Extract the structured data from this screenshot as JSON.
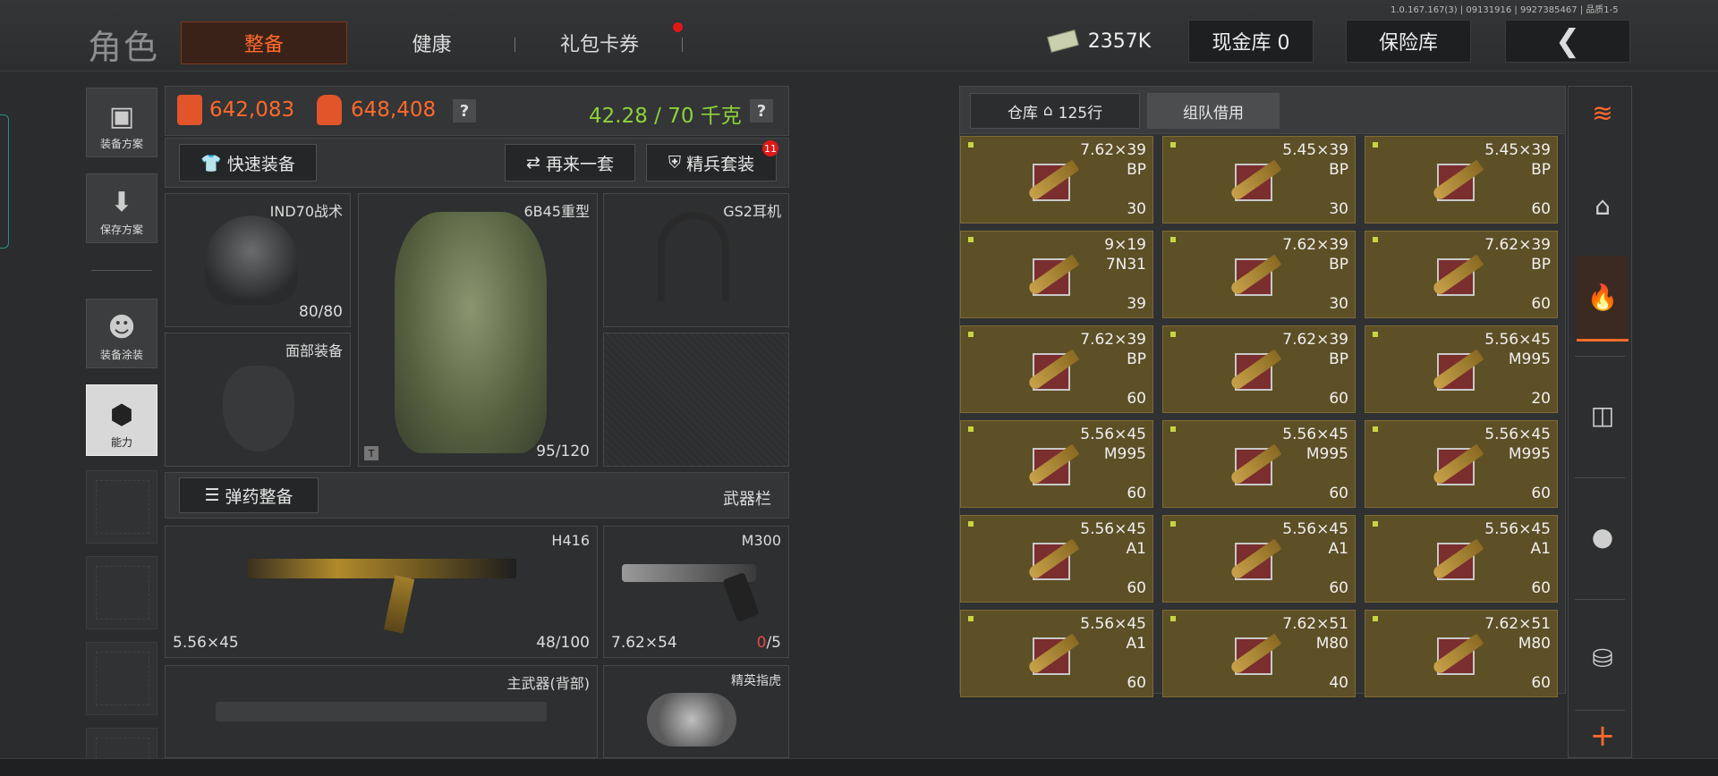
{
  "header": {
    "title": "角色",
    "tabs": [
      "整备",
      "健康",
      "礼包卡券"
    ],
    "version": "1.0.167.167(3) | 09131916 | 9927385467 | 品质1-5",
    "money": "2357K",
    "cash_vault": "现金库 0",
    "insurance": "保险库"
  },
  "left_nav": [
    "装备方案",
    "保存方案",
    "装备涂装",
    "能力"
  ],
  "stats": {
    "value1": "642,083",
    "value2": "648,408",
    "weight": "42.28 / 70 千克",
    "q": "?"
  },
  "toolbar": {
    "quick_equip": "快速装备",
    "again": "再来一套",
    "elite": "精兵套装",
    "elite_badge": "11",
    "ammo_equip": "弹药整备",
    "weapon_bar": "武器栏"
  },
  "slots": {
    "helmet_name": "IND70战术",
    "helmet_dur": "80/80",
    "face": "面部装备",
    "armor_name": "6B45重型",
    "armor_dur": "95/120",
    "armor_mark": "T",
    "headset": "GS2耳机",
    "primary_name": "H416",
    "primary_cal": "5.56×45",
    "primary_dur": "48/100",
    "sidearm_name": "M300",
    "sidearm_cal": "7.62×54",
    "sidearm_ammo_cur": "0",
    "sidearm_ammo_max": "/5",
    "back_weapon": "主武器(背部)",
    "melee": "精英指虎"
  },
  "storage": {
    "tab_warehouse": "仓库",
    "rows": "125行",
    "tab_team": "组队借用",
    "items": [
      {
        "cal": "7.62×39",
        "type": "BP",
        "qty": "30"
      },
      {
        "cal": "5.45×39",
        "type": "BP",
        "qty": "30"
      },
      {
        "cal": "5.45×39",
        "type": "BP",
        "qty": "60"
      },
      {
        "cal": "9×19",
        "type": "7N31",
        "qty": "39"
      },
      {
        "cal": "7.62×39",
        "type": "BP",
        "qty": "30"
      },
      {
        "cal": "7.62×39",
        "type": "BP",
        "qty": "60"
      },
      {
        "cal": "7.62×39",
        "type": "BP",
        "qty": "60"
      },
      {
        "cal": "7.62×39",
        "type": "BP",
        "qty": "60"
      },
      {
        "cal": "5.56×45",
        "type": "M995",
        "qty": "20"
      },
      {
        "cal": "5.56×45",
        "type": "M995",
        "qty": "60"
      },
      {
        "cal": "5.56×45",
        "type": "M995",
        "qty": "60"
      },
      {
        "cal": "5.56×45",
        "type": "M995",
        "qty": "60"
      },
      {
        "cal": "5.56×45",
        "type": "A1",
        "qty": "60"
      },
      {
        "cal": "5.56×45",
        "type": "A1",
        "qty": "60"
      },
      {
        "cal": "5.56×45",
        "type": "A1",
        "qty": "60"
      },
      {
        "cal": "5.56×45",
        "type": "A1",
        "qty": "60"
      },
      {
        "cal": "7.62×51",
        "type": "M80",
        "qty": "40"
      },
      {
        "cal": "7.62×51",
        "type": "M80",
        "qty": "60"
      }
    ]
  },
  "right_rail": {
    "plus": "+",
    "icons": [
      "stack-refresh-icon",
      "home-icon",
      "fire-hand-icon",
      "optic-icon",
      "grenade-icon",
      "coins-icon"
    ]
  },
  "colors": {
    "accent": "#ff6a2c",
    "weight_green": "#8cd33a",
    "ammo_bg": "#5d4f26"
  }
}
